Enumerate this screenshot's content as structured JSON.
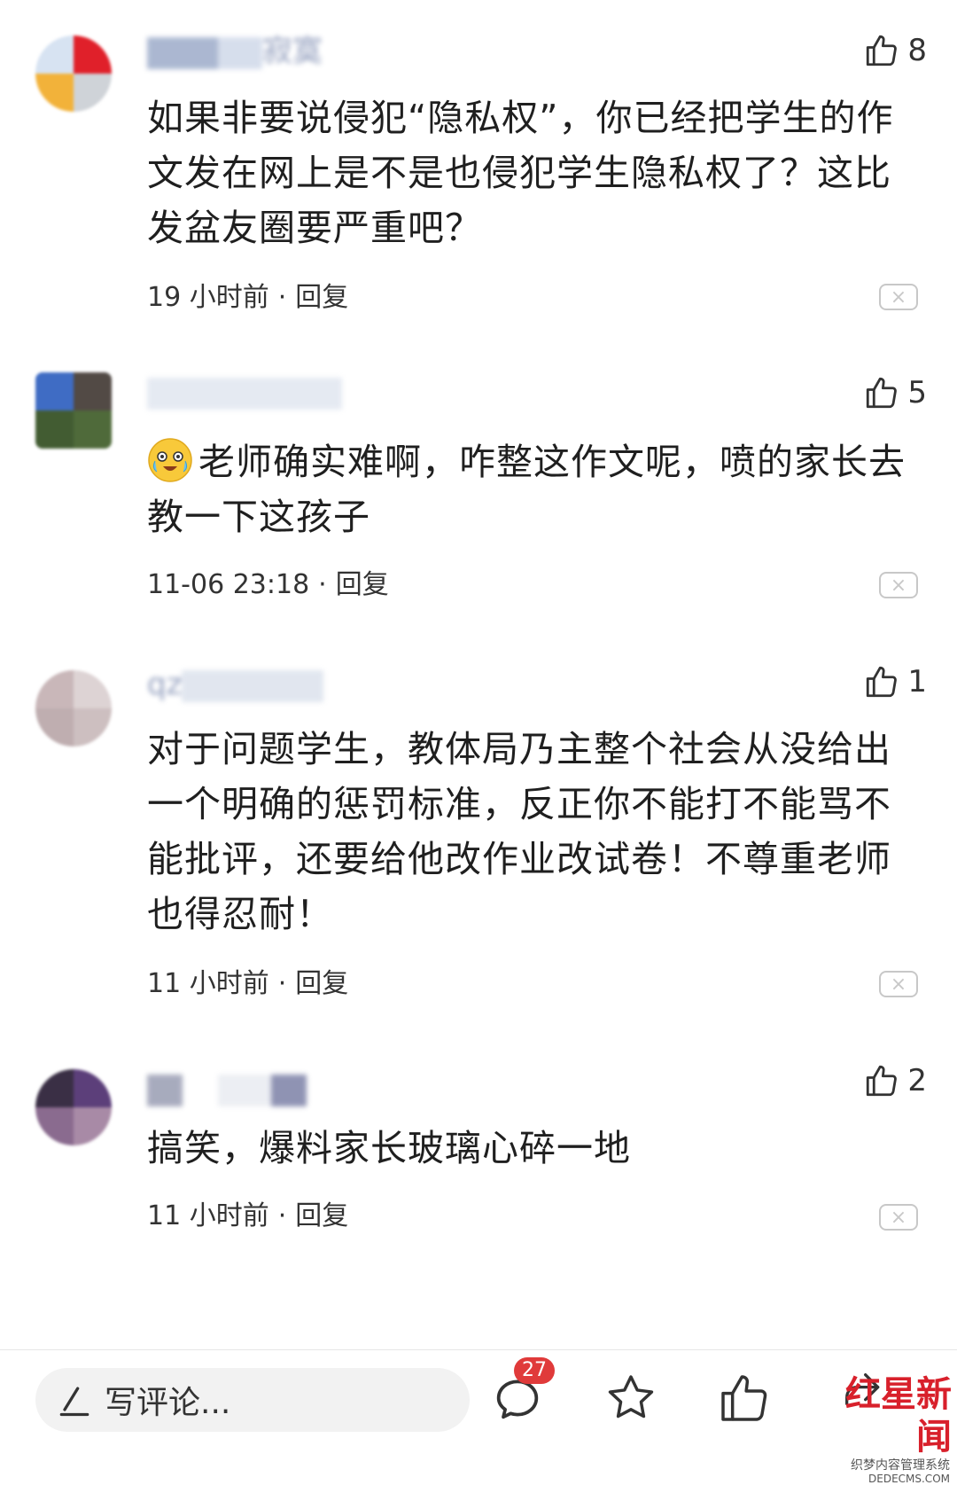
{
  "comments": [
    {
      "username": "寂寞",
      "likes": "8",
      "text": "如果非要说侵犯“隐私权”，你已经把学生的作文发在网上是不是也侵犯学生隐私权了？这比发盆友圈要严重吧？",
      "time": "19 小时前",
      "reply": "回复",
      "close": "×"
    },
    {
      "username": "",
      "likes": "5",
      "text": "老师确实难啊，咋整这作文呢，喷的家长去教一下这孩子",
      "emoji": "crying-laughing-emoji",
      "time": "11-06 23:18",
      "reply": "回复",
      "close": "×"
    },
    {
      "username": "qz",
      "likes": "1",
      "text": "对于问题学生，教体局乃主整个社会从没给出一个明确的惩罚标准，反正你不能打不能骂不能批评，还要给他改作业改试卷！不尊重老师也得忍耐！",
      "time": "11 小时前",
      "reply": "回复",
      "close": "×"
    },
    {
      "username": "",
      "likes": "2",
      "text": "搞笑，爆料家长玻璃心碎一地",
      "time": "11 小时前",
      "reply": "回复",
      "close": "×"
    }
  ],
  "bottom_bar": {
    "placeholder": "写评论...",
    "comment_count": "27"
  },
  "watermark": {
    "logo": "红星新闻",
    "subtitle": "织梦内容管理系统",
    "url": "DEDECMS.COM"
  },
  "colors": {
    "badge": "#e03a3a",
    "watermark": "#d8202b"
  }
}
